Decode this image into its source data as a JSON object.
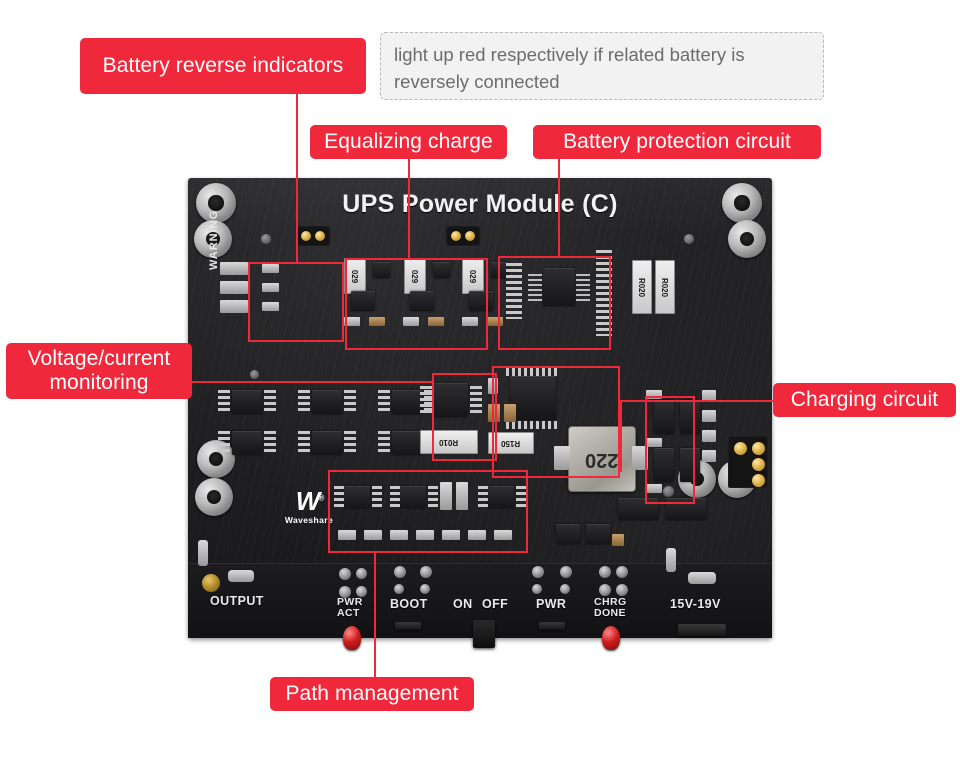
{
  "board": {
    "title": "UPS Power Module (C)",
    "brand": "Waveshare",
    "brand_mark": "W",
    "brand_reg": "®",
    "warning_silk": "WARNING",
    "bottom_labels": [
      {
        "id": "output",
        "text": "OUTPUT"
      },
      {
        "id": "pwr-act",
        "text": "PWR\nACT"
      },
      {
        "id": "boot",
        "text": "BOOT"
      },
      {
        "id": "on",
        "text": "ON"
      },
      {
        "id": "off",
        "text": "OFF"
      },
      {
        "id": "pwr",
        "text": "PWR"
      },
      {
        "id": "chrg-done",
        "text": "CHRG\nDONE"
      },
      {
        "id": "input-voltage",
        "text": "15V-19V"
      }
    ],
    "component_markings": [
      {
        "id": "d1",
        "text": "029"
      },
      {
        "id": "d2",
        "text": "029"
      },
      {
        "id": "d3",
        "text": "029"
      },
      {
        "id": "r020a",
        "text": "R020"
      },
      {
        "id": "r020b",
        "text": "R020"
      },
      {
        "id": "r010",
        "text": "R010"
      },
      {
        "id": "r150",
        "text": "R150"
      },
      {
        "id": "inductor",
        "text": "220"
      }
    ]
  },
  "callouts": [
    {
      "id": "battery-reverse-indicators",
      "text": "Battery reverse indicators"
    },
    {
      "id": "equalizing-charge",
      "text": "Equalizing charge"
    },
    {
      "id": "battery-protection-circuit",
      "text": "Battery protection circuit"
    },
    {
      "id": "voltage-current-monitoring",
      "text": "Voltage/current\nmonitoring"
    },
    {
      "id": "charging-circuit",
      "text": "Charging circuit"
    },
    {
      "id": "path-management",
      "text": "Path management"
    }
  ],
  "tooltip": {
    "text": "light up red respectively if related battery is reversely connected"
  },
  "colors": {
    "accent_red": "#f0283c",
    "tooltip_bg": "#f2f2f2",
    "tooltip_border": "#b8b8b8",
    "tooltip_text": "#6c6c6c",
    "pcb_dark": "#1e1e20",
    "silk_white": "#eaeaea"
  }
}
